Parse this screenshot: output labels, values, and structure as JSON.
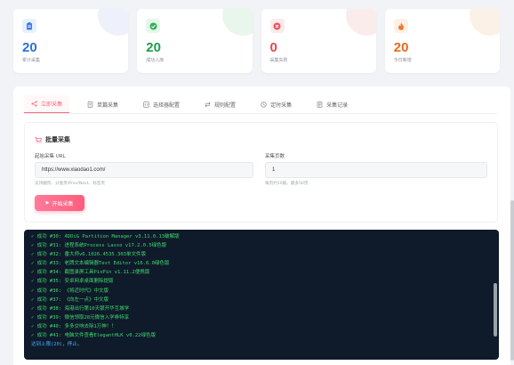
{
  "stats": [
    {
      "value": "20",
      "label": "累计采集",
      "color": "#2a6fdb",
      "icon_bg": "#e8f0fd",
      "icon_color": "#3d7ee8",
      "deco": "#eef1fb",
      "icon": "clipboard-icon"
    },
    {
      "value": "20",
      "label": "成功入库",
      "color": "#1f9d4c",
      "icon_bg": "#e5f6ea",
      "icon_color": "#2fb15a",
      "deco": "#e9f6ec",
      "icon": "check-circle-icon"
    },
    {
      "value": "0",
      "label": "采集失败",
      "color": "#e8454a",
      "icon_bg": "#fdeaea",
      "icon_color": "#ef5358",
      "deco": "#fbecec",
      "icon": "x-circle-icon"
    },
    {
      "value": "20",
      "label": "今日新增",
      "color": "#e86a1c",
      "icon_bg": "#fdf0e4",
      "icon_color": "#f07a2a",
      "deco": "#fcf1e6",
      "icon": "fire-icon"
    }
  ],
  "tabs": [
    {
      "label": "立即采集",
      "icon": "share-icon",
      "active": true
    },
    {
      "label": "单篇采集",
      "icon": "document-icon"
    },
    {
      "label": "选择器配置",
      "icon": "code-icon"
    },
    {
      "label": "规则配置",
      "icon": "swap-icon"
    },
    {
      "label": "定时采集",
      "icon": "clock-icon"
    },
    {
      "label": "采集记录",
      "icon": "list-icon"
    }
  ],
  "form": {
    "title": "批量采集",
    "url_label": "起始采集 URL",
    "url_value": "https://www.xiaodao1.com/",
    "url_hint": "支持翻页、分类页/Prev/Next、标签页",
    "pages_label": "采集页数",
    "pages_value": "1",
    "pages_hint": "每页约10篇，最多50页",
    "start_button": "开始采集"
  },
  "console": {
    "lines": [
      "✓ 成功 #30: 4DDiG Partition Manager v3.11.0.13破解版",
      "✓ 成功 #31: 进程系统Process Lasso v17.2.0.5绿色版",
      "✓ 成功 #32: 番大师v6.1026.4535.303单文件版",
      "✓ 成功 #33: 老牌文本编辑器Text Editor v16.6.0绿色版",
      "✓ 成功 #34: 截图录屏工具PixPin v1.11.2便携版",
      "✓ 成功 #35: 安卓网卓桌面删除提版",
      "✓ 成功 #36: 《将近时代》中文版",
      "✓ 成功 #37: 《向左一点》中文版",
      "✓ 成功 #38: 海港出行第10天银开华互城学",
      "✓ 成功 #39: 微信领取28元微信入学券特享",
      "✓ 成功 #40: 多多交响去除1万神！！",
      "✓ 成功 #41: 电脑文件查看ElegantHLK v0.22绿色版"
    ],
    "final": "达到上限(20)，停止。"
  }
}
